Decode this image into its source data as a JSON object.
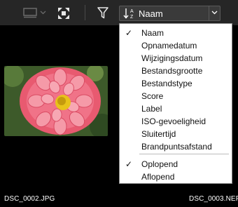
{
  "toolbar": {
    "sort_select": {
      "selected": "Naam"
    }
  },
  "sort_menu": {
    "fields": [
      {
        "label": "Naam",
        "checked": true
      },
      {
        "label": "Opnamedatum",
        "checked": false
      },
      {
        "label": "Wijzigingsdatum",
        "checked": false
      },
      {
        "label": "Bestandsgrootte",
        "checked": false
      },
      {
        "label": "Bestandstype",
        "checked": false
      },
      {
        "label": "Score",
        "checked": false
      },
      {
        "label": "Label",
        "checked": false
      },
      {
        "label": "ISO-gevoeligheid",
        "checked": false
      },
      {
        "label": "Sluitertijd",
        "checked": false
      },
      {
        "label": "Brandpuntsafstand",
        "checked": false
      }
    ],
    "order": [
      {
        "label": "Oplopend",
        "checked": true
      },
      {
        "label": "Aflopend",
        "checked": false
      }
    ],
    "check_glyph": "✓"
  },
  "files": [
    {
      "name": "DSC_0002.JPG"
    },
    {
      "name": "DSC_0003.NEF"
    }
  ],
  "colors": {
    "toolbar_bg": "#262626",
    "content_bg": "#000000",
    "menu_bg": "#ffffff",
    "flower": "#f0607a",
    "flower_center": "#e8c21a",
    "foliage": "#3d5a2a"
  },
  "icons": [
    "grid-view-icon",
    "chevron-down-icon",
    "fit-screen-icon",
    "filter-icon",
    "sort-az-icon",
    "checkmark-icon"
  ]
}
